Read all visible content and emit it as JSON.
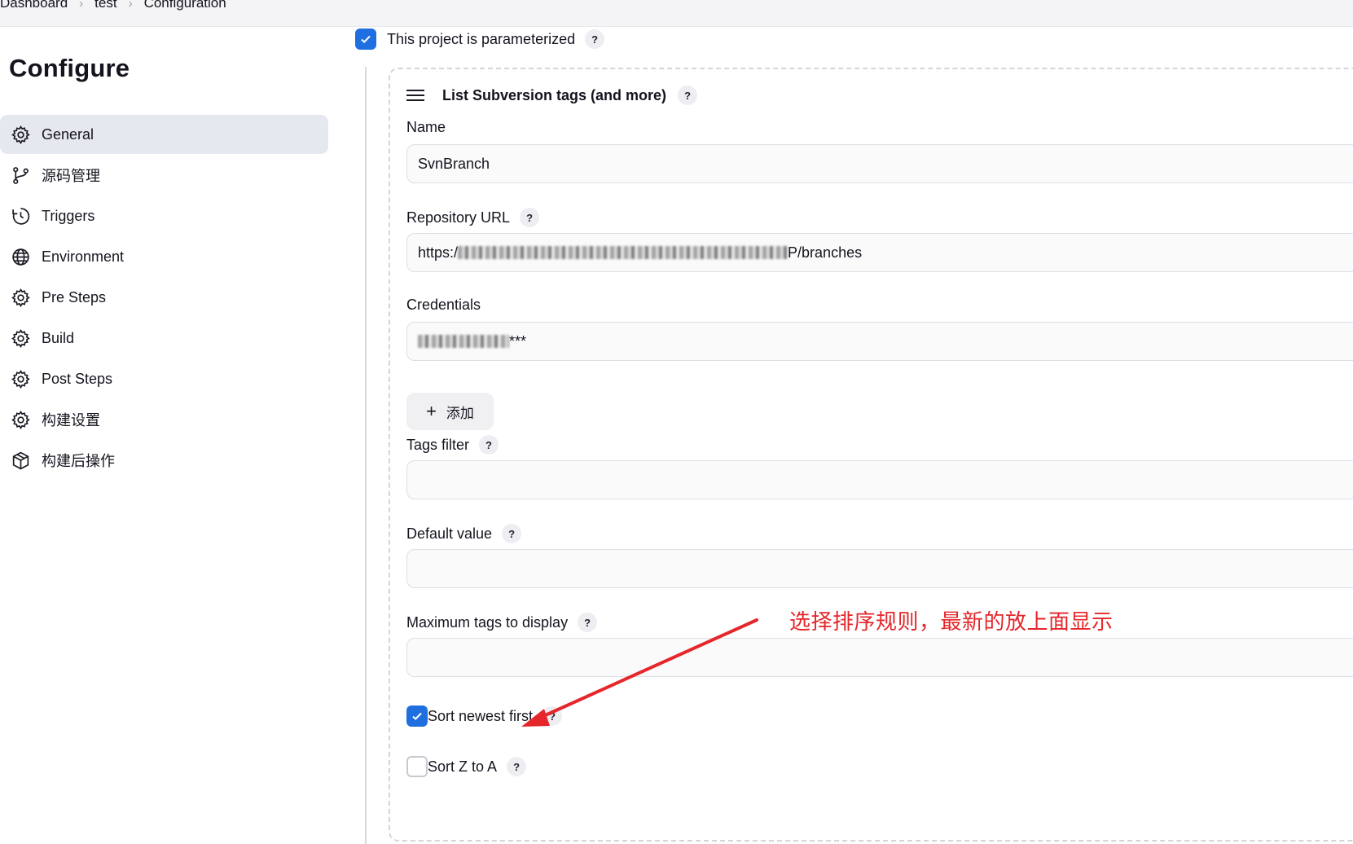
{
  "breadcrumb": [
    "Dashboard",
    "test",
    "Configuration"
  ],
  "page_title": "Configure",
  "sidebar": {
    "items": [
      {
        "label": "General",
        "icon": "gear-icon",
        "active": true
      },
      {
        "label": "源码管理",
        "icon": "branch-icon",
        "active": false
      },
      {
        "label": "Triggers",
        "icon": "clock-icon",
        "active": false
      },
      {
        "label": "Environment",
        "icon": "globe-icon",
        "active": false
      },
      {
        "label": "Pre Steps",
        "icon": "gear-icon",
        "active": false
      },
      {
        "label": "Build",
        "icon": "gear-icon",
        "active": false
      },
      {
        "label": "Post Steps",
        "icon": "gear-icon",
        "active": false
      },
      {
        "label": "构建设置",
        "icon": "gear-icon",
        "active": false
      },
      {
        "label": "构建后操作",
        "icon": "cube-icon",
        "active": false
      }
    ]
  },
  "parameterized": {
    "label": "This project is parameterized",
    "checked": true
  },
  "help_mark": "?",
  "param_block": {
    "title": "List Subversion tags (and more)",
    "name": {
      "label": "Name",
      "value": "SvnBranch"
    },
    "repo": {
      "label": "Repository URL",
      "value_prefix": "https:/",
      "value_suffix": "P/branches"
    },
    "credentials": {
      "label": "Credentials",
      "value_suffix": "***"
    },
    "add_button": {
      "plus": "+",
      "label": "添加"
    },
    "tags_filter": {
      "label": "Tags filter",
      "value": ""
    },
    "default_value": {
      "label": "Default value",
      "value": ""
    },
    "max_tags": {
      "label": "Maximum tags to display",
      "value": ""
    },
    "sort_newest": {
      "label": "Sort newest first",
      "checked": true
    },
    "sort_z_to_a": {
      "label": "Sort Z to A",
      "checked": false
    }
  },
  "annotation": {
    "text": "选择排序规则，最新的放上面显示",
    "color": "#e5262b"
  },
  "colors": {
    "accent": "#1f6fe0",
    "active_nav_bg": "#e6e8ef"
  }
}
